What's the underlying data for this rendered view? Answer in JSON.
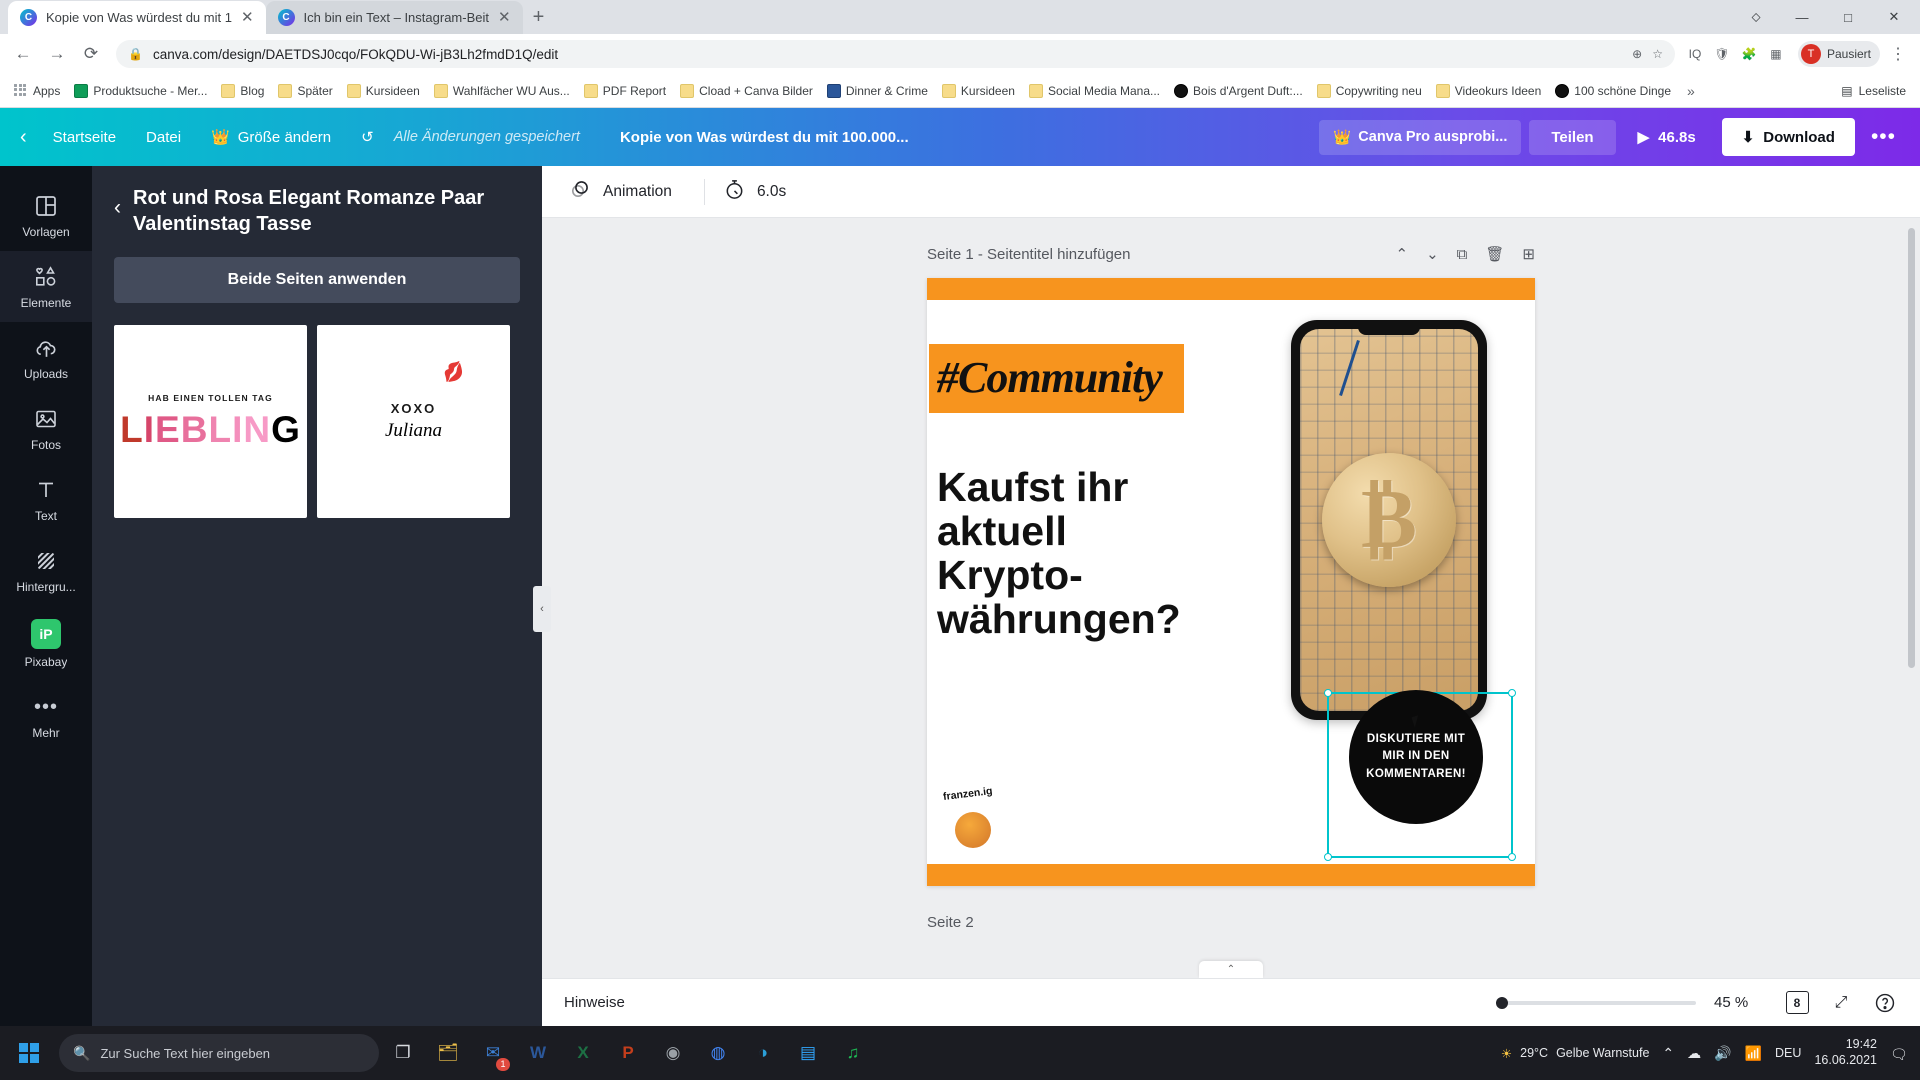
{
  "browser": {
    "tabs": [
      {
        "title": "Kopie von Was würdest du mit 1",
        "favicon": "canva-icon",
        "active": true,
        "close": "✕"
      },
      {
        "title": "Ich bin ein Text – Instagram-Beit",
        "favicon": "canva-icon",
        "active": false,
        "close": "✕"
      }
    ],
    "new_tab_label": "+",
    "window_controls": {
      "minimize": "—",
      "maximize": "□",
      "close": "✕",
      "extension": "⬦"
    },
    "nav": {
      "back": "←",
      "forward": "→",
      "reload": "⟳"
    },
    "omnibox": {
      "lock_icon": "🔒",
      "url": "canva.com/design/DAETDSJ0cqo/FOkQDU-Wi-jB3Lh2fmdD1Q/edit",
      "zoom_icon": "⊕",
      "star_icon": "☆"
    },
    "extensions": [
      "IQ",
      "puzzle-icon",
      "grid-icon"
    ],
    "profile": {
      "initial": "T",
      "label": "Pausiert"
    },
    "menu": "⋮",
    "bookmarks": [
      {
        "label": "Apps",
        "icon": "apps-grid"
      },
      {
        "label": "Produktsuche - Mer...",
        "icon": "green-app"
      },
      {
        "label": "Blog",
        "icon": "folder"
      },
      {
        "label": "Später",
        "icon": "folder"
      },
      {
        "label": "Kursideen",
        "icon": "folder"
      },
      {
        "label": "Wahlfächer WU Aus...",
        "icon": "folder"
      },
      {
        "label": "PDF Report",
        "icon": "folder"
      },
      {
        "label": "Cload + Canva Bilder",
        "icon": "folder"
      },
      {
        "label": "Dinner & Crime",
        "icon": "indesign"
      },
      {
        "label": "Kursideen",
        "icon": "folder"
      },
      {
        "label": "Social Media Mana...",
        "icon": "folder"
      },
      {
        "label": "Bois d'Argent Duft:...",
        "icon": "black-circle"
      },
      {
        "label": "Copywriting neu",
        "icon": "folder"
      },
      {
        "label": "Videokurs Ideen",
        "icon": "folder"
      },
      {
        "label": "100 schöne Dinge",
        "icon": "bold-b"
      }
    ],
    "bookmarks_overflow": "»",
    "reading_list": {
      "label": "Leseliste",
      "icon": "reading-list-icon"
    }
  },
  "canva_toolbar": {
    "back_arrow": "‹",
    "home": "Startseite",
    "file": "Datei",
    "resize": "Größe ändern",
    "resize_icon": "crown-icon",
    "undo_icon": "↺",
    "saved_status": "Alle Änderungen gespeichert",
    "doc_title": "Kopie von Was würdest du mit 100.000...",
    "try_pro": "Canva Pro ausprobi...",
    "try_pro_icon": "crown-icon",
    "share": "Teilen",
    "present_time": "46.8s",
    "present_icon": "play-icon",
    "download": "Download",
    "download_icon": "download-icon",
    "more": "•••"
  },
  "rail": {
    "items": [
      {
        "label": "Vorlagen",
        "icon": "templates-icon",
        "selected": false
      },
      {
        "label": "Elemente",
        "icon": "elements-icon",
        "selected": true
      },
      {
        "label": "Uploads",
        "icon": "upload-cloud-icon",
        "selected": false
      },
      {
        "label": "Fotos",
        "icon": "photo-icon",
        "selected": false
      },
      {
        "label": "Text",
        "icon": "text-icon",
        "selected": false
      },
      {
        "label": "Hintergru...",
        "icon": "background-icon",
        "selected": false
      },
      {
        "label": "Pixabay",
        "icon": "pixabay-icon",
        "selected": false
      },
      {
        "label": "Mehr",
        "icon": "more-dots-icon",
        "selected": false
      }
    ]
  },
  "panel": {
    "back_arrow": "‹",
    "title": "Rot und Rosa Elegant Romanze Paar Valentinstag Tasse",
    "apply_button": "Beide Seiten anwenden",
    "collapse_icon": "‹",
    "thumbnails": [
      {
        "top_text": "HAB EINEN TOLLEN TAG",
        "main_text": "LIEBLING"
      },
      {
        "top_text": "XOXO",
        "main_text": "Juliana",
        "lips_icon": "lips-icon"
      }
    ]
  },
  "animation_bar": {
    "animation_label": "Animation",
    "animation_icon": "animation-circles-icon",
    "duration": "6.0s",
    "duration_icon": "stopwatch-icon"
  },
  "canvas": {
    "page_label": "Seite 1 - Seitentitel hinzufügen",
    "page2_label": "Seite 2",
    "tools": {
      "move_up": "⌃",
      "move_down": "⌄",
      "duplicate": "duplicate-icon",
      "delete": "trash-icon",
      "add_page": "add-page-icon"
    },
    "design": {
      "community_text": "#Community",
      "headline": "Kaufst ihr aktuell Krypto-währungen?",
      "cta_text": "DISKUTIERE MIT MIR IN DEN KOMMENTAREN!",
      "bitcoin_symbol": "₿",
      "logo_text": "franzen.ig",
      "accent_orange": "#f7941e",
      "selection_color": "#00c4cc"
    }
  },
  "status_bar": {
    "notes": "Hinweise",
    "zoom_percent": "45 %",
    "page_count": "8",
    "fullscreen_icon": "expand-icon",
    "help_icon": "?",
    "grid_icon": "pages-icon"
  },
  "taskbar": {
    "start_icon": "windows-logo",
    "search_placeholder": "Zur Suche Text hier eingeben",
    "search_icon": "search-icon",
    "apps": [
      {
        "name": "task-view-icon",
        "glyph": "❐",
        "badge": ""
      },
      {
        "name": "file-explorer-icon",
        "glyph": "🗂",
        "badge": ""
      },
      {
        "name": "outlook-icon",
        "glyph": "✉",
        "badge": "1"
      },
      {
        "name": "word-icon",
        "glyph": "W",
        "badge": ""
      },
      {
        "name": "excel-icon",
        "glyph": "X",
        "badge": ""
      },
      {
        "name": "powerpoint-icon",
        "glyph": "P",
        "badge": ""
      },
      {
        "name": "browser-icon",
        "glyph": "◉",
        "badge": ""
      },
      {
        "name": "chrome-icon",
        "glyph": "◍",
        "badge": ""
      },
      {
        "name": "edge-icon",
        "glyph": "◑",
        "badge": ""
      },
      {
        "name": "photoshop-icon",
        "glyph": "▤",
        "badge": ""
      },
      {
        "name": "spotify-icon",
        "glyph": "♫",
        "badge": ""
      }
    ],
    "weather": {
      "temp": "29°C",
      "text": "Gelbe Warnstufe",
      "icon": "sun-icon"
    },
    "tray": {
      "chevron": "⌃",
      "onedrive": "☁",
      "volume": "🔊",
      "network": "📶"
    },
    "language": "DEU",
    "time": "19:42",
    "date": "16.06.2021"
  }
}
